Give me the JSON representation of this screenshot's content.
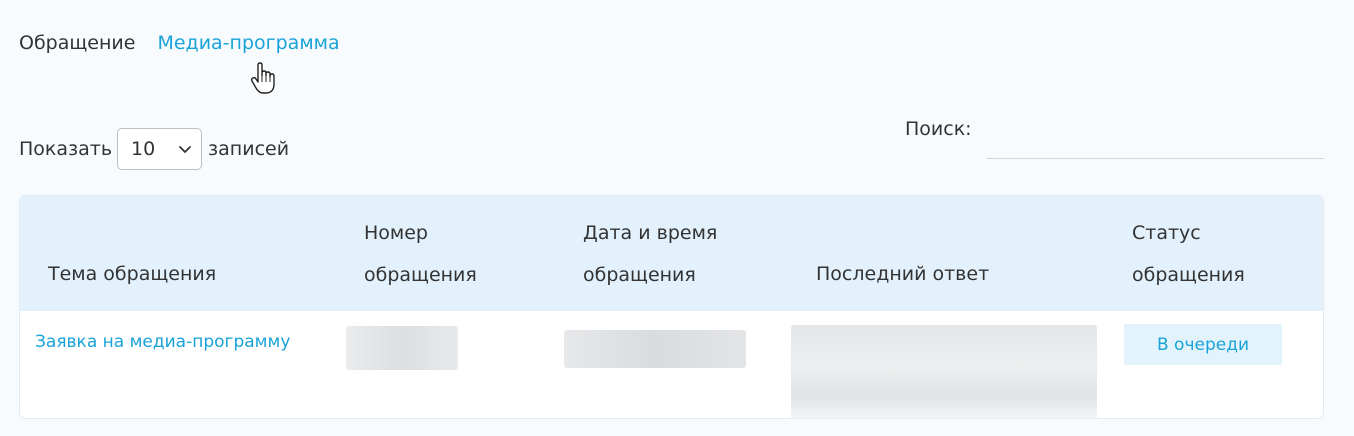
{
  "breadcrumb": {
    "items": [
      {
        "label": "Обращение"
      },
      {
        "label": "Медиа-программа"
      }
    ]
  },
  "length": {
    "prefix": "Показать",
    "selected": "10",
    "suffix": "записей"
  },
  "search": {
    "label": "Поиск:",
    "value": ""
  },
  "table": {
    "columns": [
      {
        "line1": "",
        "line2": "Тема обращения"
      },
      {
        "line1": "Номер",
        "line2": "обращения"
      },
      {
        "line1": "Дата и время",
        "line2": "обращения"
      },
      {
        "line1": "",
        "line2": "Последний ответ"
      },
      {
        "line1": "Статус",
        "line2": "обращения"
      }
    ],
    "rows": [
      {
        "topic": "Заявка на медиа-программу",
        "status": "В очереди"
      }
    ]
  },
  "icons": {
    "cursor": "hand-pointer-icon",
    "select_arrow": "chevron-down-icon"
  },
  "colors": {
    "accent": "#1aa3d8",
    "header_bg": "#e2f1fc",
    "badge_bg": "#e2f3fb",
    "page_bg": "#f8fbfe"
  }
}
